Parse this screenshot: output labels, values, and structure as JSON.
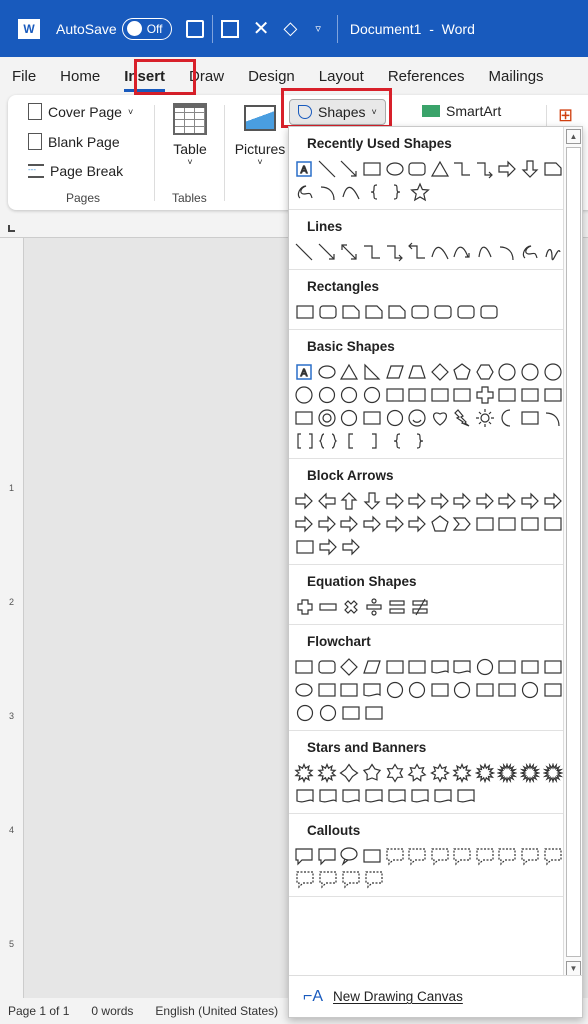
{
  "titlebar": {
    "autosave_label": "AutoSave",
    "autosave_state": "Off",
    "document_title": "Document1  -  Word"
  },
  "tabs": [
    "File",
    "Home",
    "Insert",
    "Draw",
    "Design",
    "Layout",
    "References",
    "Mailings"
  ],
  "active_tab": "Insert",
  "ribbon": {
    "cover_page": "Cover Page",
    "blank_page": "Blank Page",
    "page_break": "Page Break",
    "pages_group": "Pages",
    "table": "Table",
    "tables_group": "Tables",
    "pictures": "Pictures",
    "shapes": "Shapes",
    "smartart": "SmartArt"
  },
  "ruler_numbers": [
    "1",
    "2",
    "3",
    "4",
    "5"
  ],
  "status": {
    "page": "Page 1 of 1",
    "words": "0 words",
    "language": "English (United States)"
  },
  "shapes_panel": {
    "sections": [
      {
        "title": "Recently Used Shapes",
        "rows": [
          [
            "textbox",
            "line",
            "arrow",
            "rect",
            "oval",
            "roundrect",
            "triangle",
            "elbow",
            "elbowarrow",
            "rightarrow",
            "downarrow",
            "snip"
          ],
          [
            "freeform",
            "arc",
            "curve",
            "lbrace",
            "rbrace",
            "star"
          ]
        ]
      },
      {
        "title": "Lines",
        "rows": [
          [
            "line",
            "arrow",
            "dblarrow",
            "elbow",
            "elbowarrow",
            "elbowdbl",
            "curve",
            "curvearrow",
            "curvedbl",
            "arc",
            "freeform",
            "scribble"
          ]
        ]
      },
      {
        "title": "Rectangles",
        "rows": [
          [
            "rect",
            "roundrect",
            "snip",
            "snip",
            "snip",
            "roundrect",
            "roundrect",
            "roundrect",
            "roundrect"
          ]
        ]
      },
      {
        "title": "Basic Shapes",
        "rows": [
          [
            "textbox",
            "oval",
            "triangle",
            "rtriangle",
            "parallelogram",
            "trapezoid",
            "diamond",
            "pentagon",
            "hexagon",
            "heptagon",
            "octagon",
            "decagon"
          ],
          [
            "dodecagon",
            "pie",
            "chord",
            "teardrop",
            "frame",
            "halfframe",
            "lshape",
            "diagstripe",
            "cross",
            "plaque",
            "can",
            "cube"
          ],
          [
            "bevel",
            "donut",
            "nosymbol",
            "blockarc",
            "foldedcorner",
            "smiley",
            "heart",
            "lightning",
            "sun",
            "moon",
            "cloud",
            "arc"
          ],
          [
            "dblbracket",
            "dblbrace",
            "lbracket",
            "rbracket",
            "lbrace",
            "rbrace"
          ]
        ]
      },
      {
        "title": "Block Arrows",
        "rows": [
          [
            "rightarrow",
            "leftarrow",
            "uparrow",
            "downarrow",
            "lrarrow",
            "udarrow",
            "quadarrow",
            "lrup",
            "bent",
            "uturn",
            "leftup",
            "bentup"
          ],
          [
            "curvedright",
            "curvedleft",
            "curvedup",
            "curveddown",
            "striped",
            "notched",
            "pentagon",
            "chevron",
            "rightcallout",
            "downcallout",
            "leftcallout",
            "udcallout"
          ],
          [
            "quadcallout",
            "quadarrow",
            "circulararrow"
          ]
        ]
      },
      {
        "title": "Equation Shapes",
        "rows": [
          [
            "plus",
            "minus",
            "multiply",
            "divide",
            "equal",
            "notequal"
          ]
        ]
      },
      {
        "title": "Flowchart",
        "rows": [
          [
            "rect",
            "roundrect",
            "diamond",
            "parallelogram",
            "predefined",
            "internal",
            "document",
            "multidoc",
            "terminator",
            "preparation",
            "manualinput",
            "manualop"
          ],
          [
            "oval",
            "offpage",
            "card",
            "punchedtape",
            "sumjunction",
            "or",
            "collate",
            "sort",
            "extract",
            "merge",
            "storeddata",
            "delay"
          ],
          [
            "seqaccess",
            "magdisk",
            "directaccess",
            "display"
          ]
        ]
      },
      {
        "title": "Stars and Banners",
        "rows": [
          [
            "explosion1",
            "explosion2",
            "star4",
            "star5",
            "star6",
            "star7",
            "star8",
            "star10",
            "star12",
            "star16",
            "star24",
            "star32"
          ],
          [
            "ribbon",
            "ribbon",
            "ribbon",
            "ribbon",
            "scroll",
            "scroll",
            "wave",
            "wave"
          ]
        ]
      },
      {
        "title": "Callouts",
        "rows": [
          [
            "rectcallout",
            "roundcallout",
            "ovalcallout",
            "cloudcallout",
            "linecallout",
            "linecallout",
            "linecallout",
            "linecallout",
            "linecallout",
            "linecallout",
            "linecallout",
            "linecallout"
          ],
          [
            "linecallout",
            "linecallout",
            "linecallout",
            "linecallout"
          ]
        ]
      }
    ],
    "new_drawing_canvas": "New Drawing Canvas"
  },
  "colors": {
    "titlebar": "#185abd",
    "highlight": "#d8202a",
    "accent": "#185abd"
  }
}
